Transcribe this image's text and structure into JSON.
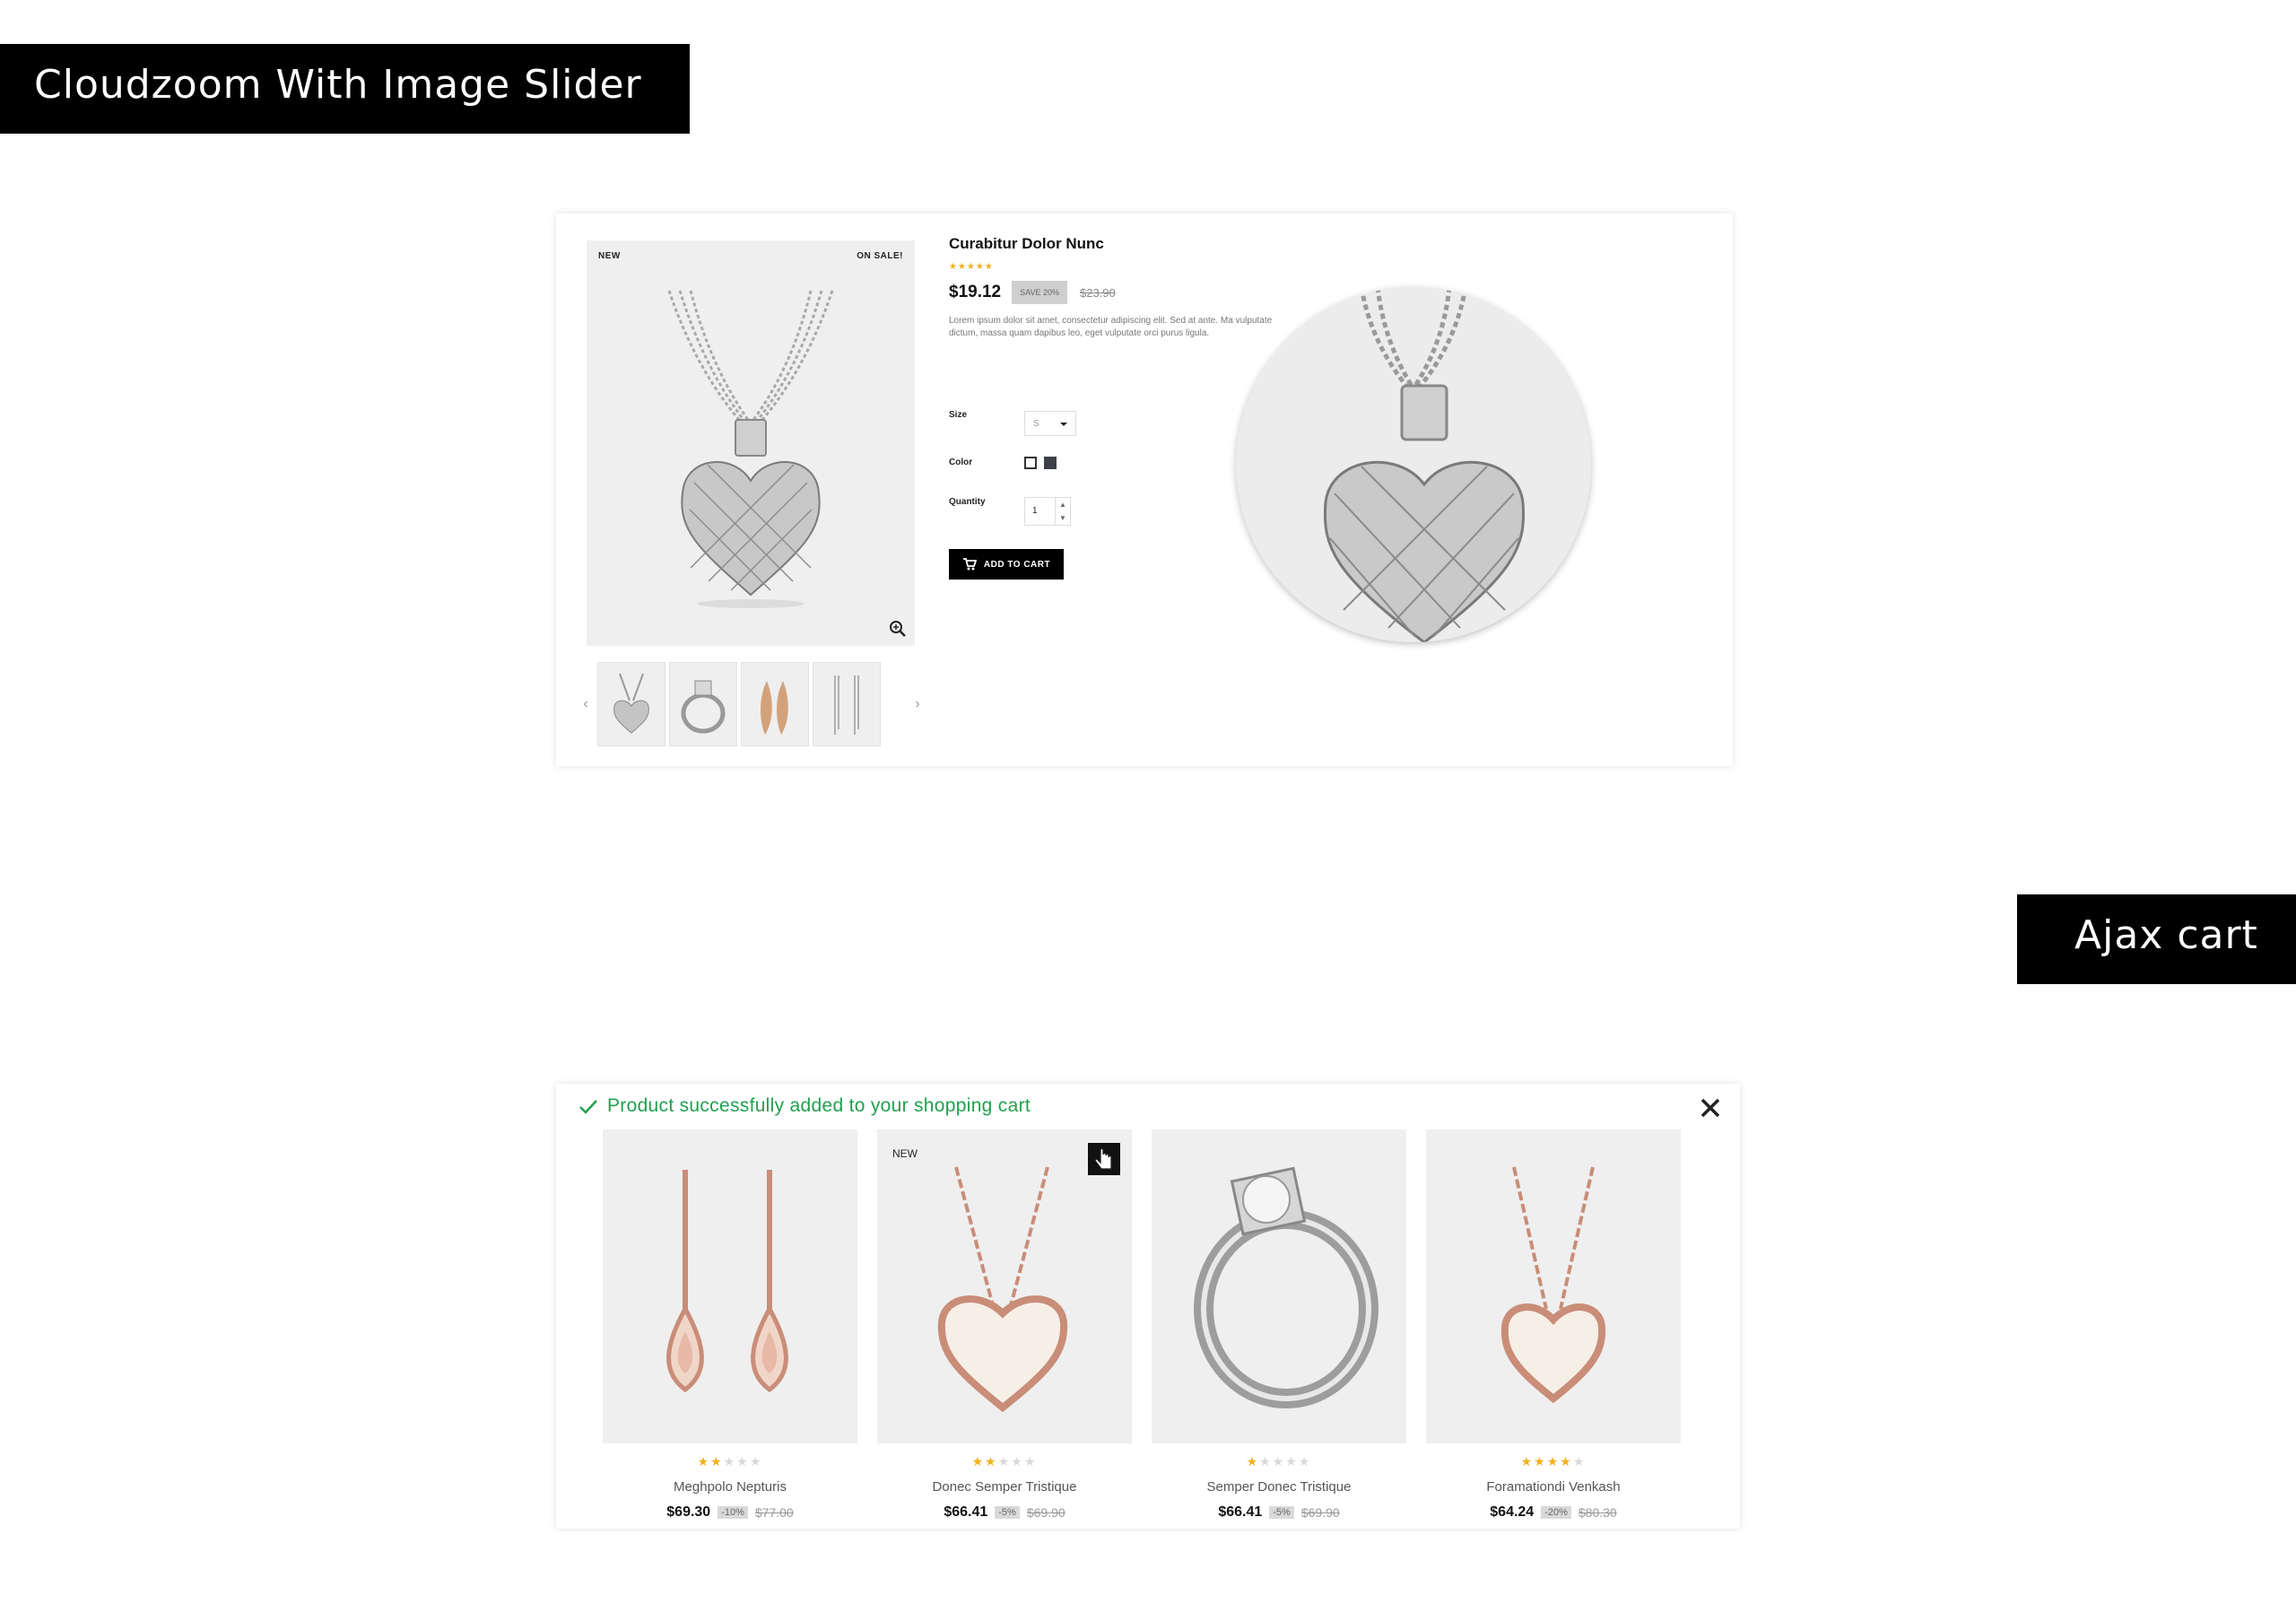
{
  "banners": {
    "cloudzoom": "Cloudzoom With Image Slider",
    "ajax": "Ajax cart"
  },
  "product": {
    "badge_new": "NEW",
    "badge_sale": "ON SALE!",
    "name": "Curabitur Dolor Nunc",
    "rating": 5,
    "price": "$19.12",
    "discount": "SAVE 20%",
    "old_price": "$23.90",
    "description": "Lorem ipsum dolor sit amet, consectetur adipiscing elit. Sed at ante. Ma vulputate dictum, massa quam dapibus leo, eget vulputate orci purus ligula.",
    "size_label": "Size",
    "size_value": "S",
    "color_label": "Color",
    "colors": [
      "#ffffff",
      "#3d4047"
    ],
    "quantity_label": "Quantity",
    "quantity_value": "1",
    "add_to_cart": "ADD TO CART",
    "thumbnails": [
      "heart-pendant",
      "diamond-ring",
      "leaf-earrings",
      "chain-earrings"
    ]
  },
  "ajax_cart": {
    "success_message": "Product successfully added to your shopping cart",
    "products": [
      {
        "name": "Meghpolo Nepturis",
        "rating": 2,
        "price": "$69.30",
        "discount": "-10%",
        "old_price": "$77.00",
        "badge": ""
      },
      {
        "name": "Donec Semper Tristique",
        "rating": 2,
        "price": "$66.41",
        "discount": "-5%",
        "old_price": "$69.90",
        "badge": "NEW"
      },
      {
        "name": "Semper Donec Tristique",
        "rating": 1,
        "price": "$66.41",
        "discount": "-5%",
        "old_price": "$69.90",
        "badge": ""
      },
      {
        "name": "Foramationdi Venkash",
        "rating": 4,
        "price": "$64.24",
        "discount": "-20%",
        "old_price": "$80.30",
        "badge": ""
      }
    ]
  },
  "colors": {
    "accent_black": "#000000",
    "star": "#f2b01e",
    "success": "#22a04f"
  }
}
